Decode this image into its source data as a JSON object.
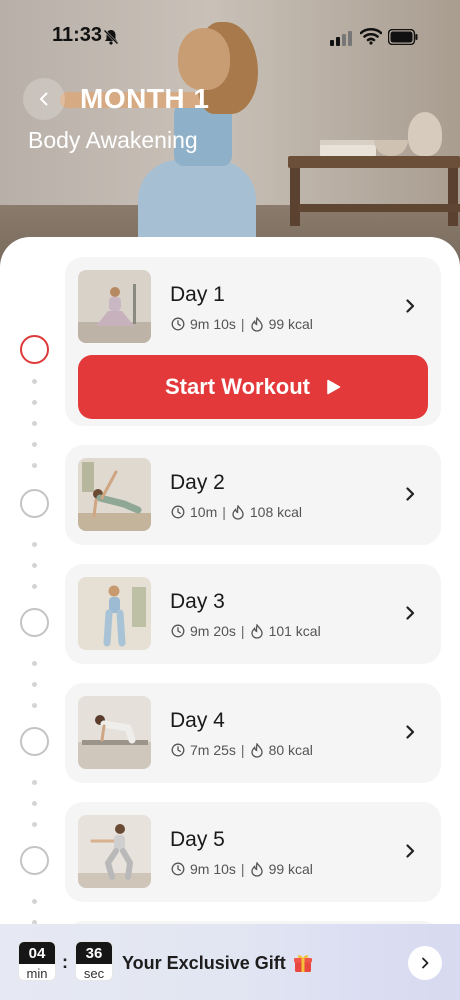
{
  "status_bar": {
    "time": "11:33"
  },
  "header": {
    "title": "MONTH 1",
    "subtitle": "Body Awakening"
  },
  "days": [
    {
      "title": "Day 1",
      "duration": "9m 10s",
      "calories": "99 kcal",
      "active": true
    },
    {
      "title": "Day 2",
      "duration": "10m",
      "calories": "108 kcal",
      "active": false
    },
    {
      "title": "Day 3",
      "duration": "9m 20s",
      "calories": "101 kcal",
      "active": false
    },
    {
      "title": "Day 4",
      "duration": "7m 25s",
      "calories": "80 kcal",
      "active": false
    },
    {
      "title": "Day 5",
      "duration": "9m 10s",
      "calories": "99 kcal",
      "active": false
    }
  ],
  "start_button": {
    "label": "Start Workout"
  },
  "promo": {
    "minutes": "04",
    "minutes_unit": "min",
    "seconds": "36",
    "seconds_unit": "sec",
    "separator": ":",
    "text": "Your Exclusive Gift"
  },
  "icons": {
    "back": "chevron-left-icon",
    "chevron": "chevron-right-icon",
    "clock": "clock-icon",
    "calories": "flame-icon",
    "play": "play-icon",
    "gift": "gift-icon",
    "bell_muted": "bell-slash-icon",
    "signal": "signal-icon",
    "wifi": "wifi-icon",
    "battery": "battery-icon"
  },
  "colors": {
    "accent": "#e3393a",
    "card_bg": "#f5f5f5",
    "timeline_inactive": "#c4c4c4"
  }
}
